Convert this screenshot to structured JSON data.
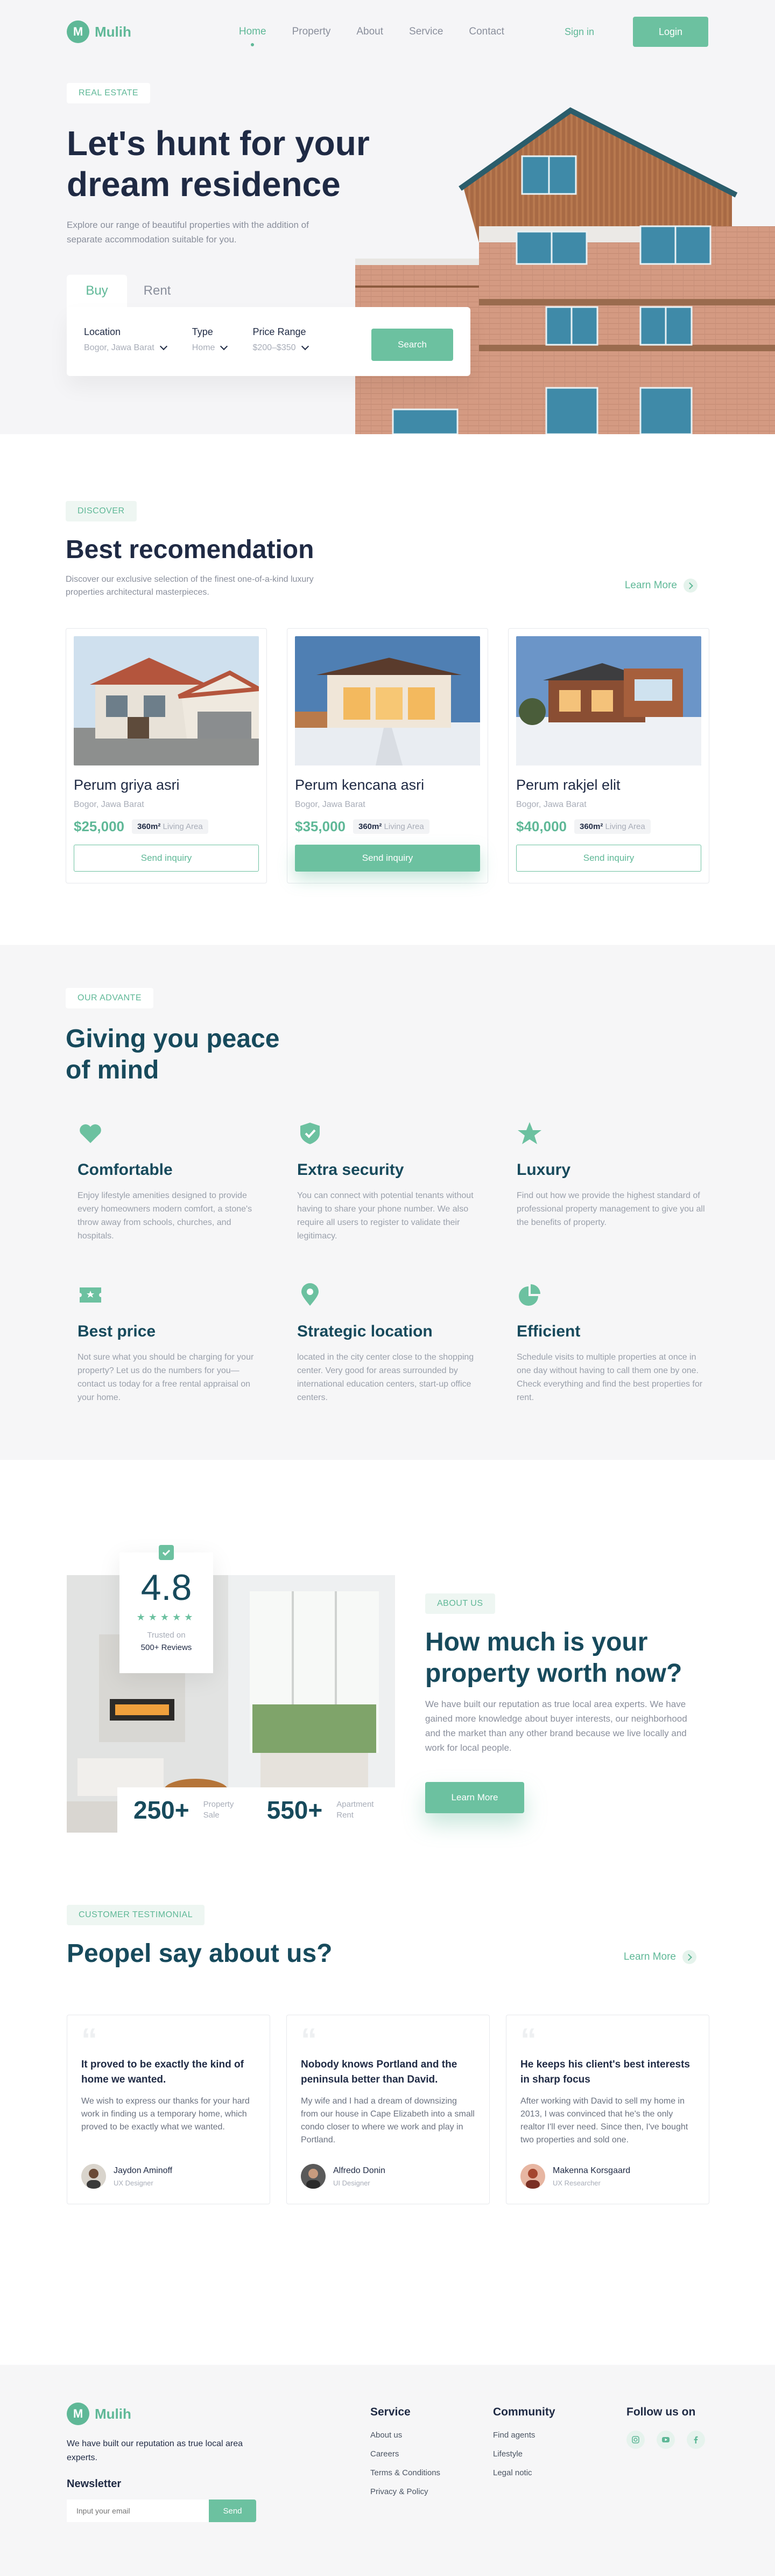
{
  "nav": {
    "logo_letter": "M",
    "logo_text": "Mulih",
    "items": [
      "Home",
      "Property",
      "About",
      "Service",
      "Contact"
    ],
    "signin": "Sign in",
    "login": "Login"
  },
  "hero": {
    "tag": "REAL ESTATE",
    "title_line1": "Let's hunt for your",
    "title_line2": "dream residence",
    "subtitle": "Explore our range of beautiful properties with the addition of separate accommodation suitable for you.",
    "tabs": [
      "Buy",
      "Rent"
    ],
    "fields": [
      {
        "label": "Location",
        "value": "Bogor, Jawa Barat"
      },
      {
        "label": "Type",
        "value": "Home"
      },
      {
        "label": "Price Range",
        "value": "$200–$350"
      }
    ],
    "search": "Search"
  },
  "recommend": {
    "tag": "DISCOVER",
    "title": "Best recomendation",
    "desc": "Discover our exclusive selection of the finest one-of-a-kind luxury properties architectural masterpieces.",
    "learn": "Learn More",
    "cards": [
      {
        "title": "Perum griya asri",
        "loc": "Bogor, Jawa Barat",
        "price": "$25,000",
        "area_num": "360m²",
        "area_lbl": "Living Area",
        "btn": "Send inquiry"
      },
      {
        "title": "Perum kencana asri",
        "loc": "Bogor, Jawa Barat",
        "price": "$35,000",
        "area_num": "360m²",
        "area_lbl": "Living Area",
        "btn": "Send inquiry"
      },
      {
        "title": "Perum rakjel elit",
        "loc": "Bogor, Jawa Barat",
        "price": "$40,000",
        "area_num": "360m²",
        "area_lbl": "Living Area",
        "btn": "Send inquiry"
      }
    ]
  },
  "advantage": {
    "tag": "OUR ADVANTE",
    "title_line1": "Giving you peace",
    "title_line2": "of mind",
    "features": [
      {
        "icon": "heart-icon",
        "title": "Comfortable",
        "desc": "Enjoy lifestyle amenities designed to provide every homeowners modern comfort, a stone's throw away from schools, churches, and hospitals."
      },
      {
        "icon": "shield-check-icon",
        "title": "Extra security",
        "desc": "You can connect with potential tenants without having to share your phone number. We also require all users to register to validate their legitimacy."
      },
      {
        "icon": "star-icon",
        "title": "Luxury",
        "desc": "Find out how we provide the highest standard of professional property management to give you all the benefits of property."
      },
      {
        "icon": "ticket-icon",
        "title": "Best price",
        "desc": "Not sure what you should be charging for your property? Let us do the numbers for you—contact us today for a free rental appraisal on your home."
      },
      {
        "icon": "location-pin-icon",
        "title": "Strategic location",
        "desc": "located in the city center close to the shopping center. Very good for areas surrounded by international education centers, start-up office centers."
      },
      {
        "icon": "pie-chart-icon",
        "title": "Efficient",
        "desc": "Schedule visits to multiple properties at once in one day without having to call them one by one. Check everything and find the best properties for rent."
      }
    ]
  },
  "about": {
    "rating": "4.8",
    "trusted": "Trusted on",
    "reviews": "500+ Reviews",
    "stars": 5,
    "stat1_num": "250+",
    "stat1_lbl": "Property Sale",
    "stat2_num": "550+",
    "stat2_lbl": "Apartment Rent",
    "tag": "ABOUT US",
    "title_line1": "How much is your",
    "title_line2": "property worth now?",
    "desc": "We have built our reputation as true local area experts. We have gained more knowledge about buyer interests, our neighborhood and the market than any other brand because we live locally and work for local people.",
    "btn": "Learn More"
  },
  "testimonials": {
    "tag": "CUSTOMER TESTIMONIAL",
    "title": "Peopel say about us?",
    "learn": "Learn More",
    "items": [
      {
        "title": "It proved to be exactly the kind of home we wanted.",
        "body": "We wish to express our thanks for your hard work in finding us a temporary home, which proved to be exactly what we wanted.",
        "name": "Jaydon Aminoff",
        "role": "UX Designer"
      },
      {
        "title": "Nobody knows Portland and the peninsula better than David.",
        "body": "My wife and I had a dream of downsizing from our house in Cape Elizabeth into a small condo closer to where we work and play in Portland.",
        "name": "Alfredo Donin",
        "role": "UI Designer"
      },
      {
        "title": "He keeps his client's best interests in sharp focus",
        "body": "After working with David to sell my home in 2013, I was convinced that he's the only realtor I'll ever need. Since then, I've bought two properties and sold one.",
        "name": "Makenna Korsgaard",
        "role": "UX Researcher"
      }
    ]
  },
  "footer": {
    "logo_letter": "M",
    "logo_text": "Mulih",
    "about": "We have built our reputation as true local area experts.",
    "newsletter": "Newsletter",
    "input_placeholder": "Input your email",
    "send": "Send",
    "service_title": "Service",
    "service_links": [
      "About us",
      "Careers",
      "Terms & Conditions",
      "Privacy & Policy"
    ],
    "community_title": "Community",
    "community_links": [
      "Find agents",
      "Lifestyle",
      "Legal notic"
    ],
    "follow_title": "Follow us on",
    "social_icons": [
      "instagram-icon",
      "youtube-icon",
      "facebook-icon"
    ]
  },
  "colors": {
    "accent": "#6cc1a0",
    "dark": "#1f2a44",
    "teal_dark": "#174a5c"
  }
}
